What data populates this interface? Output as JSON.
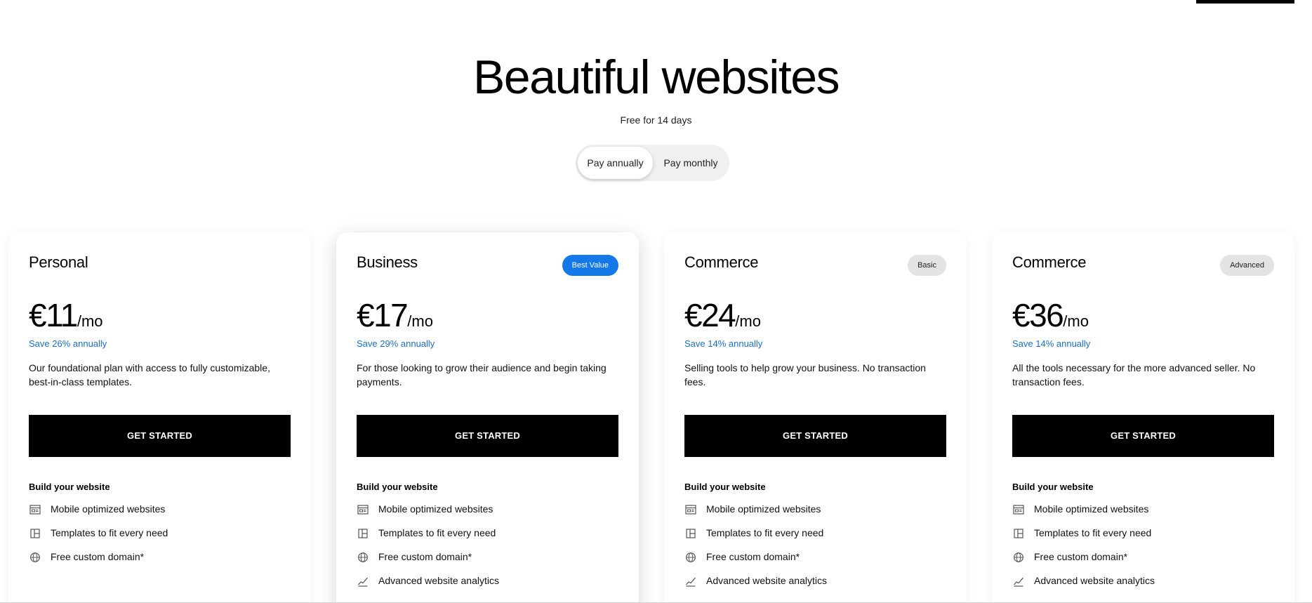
{
  "hero": {
    "title": "Beautiful websites",
    "subtitle": "Free for 14 days"
  },
  "billing_toggle": {
    "options": [
      "Pay annually",
      "Pay monthly"
    ],
    "selected": "Pay annually"
  },
  "plans": [
    {
      "name": "Personal",
      "badge": "",
      "price": "€11",
      "unit": "/mo",
      "savings": "Save 26% annually",
      "description": "Our foundational plan with access to fully customizable, best-in-class templates.",
      "cta": "GET STARTED",
      "feature_heading": "Build your website",
      "features": [
        {
          "icon": "browser-window-icon",
          "label": "Mobile optimized websites"
        },
        {
          "icon": "templates-layout-icon",
          "label": "Templates to fit every need"
        },
        {
          "icon": "globe-icon",
          "label": "Free custom domain*"
        }
      ]
    },
    {
      "name": "Business",
      "badge": "Best Value",
      "price": "€17",
      "unit": "/mo",
      "savings": "Save 29% annually",
      "description": "For those looking to grow their audience and begin taking payments.",
      "cta": "GET STARTED",
      "feature_heading": "Build your website",
      "features": [
        {
          "icon": "browser-window-icon",
          "label": "Mobile optimized websites"
        },
        {
          "icon": "templates-layout-icon",
          "label": "Templates to fit every need"
        },
        {
          "icon": "globe-icon",
          "label": "Free custom domain*"
        },
        {
          "icon": "analytics-trend-icon",
          "label": "Advanced website analytics"
        }
      ]
    },
    {
      "name": "Commerce",
      "badge": "Basic",
      "price": "€24",
      "unit": "/mo",
      "savings": "Save 14% annually",
      "description": "Selling tools to help grow your business. No transaction fees.",
      "cta": "GET STARTED",
      "feature_heading": "Build your website",
      "features": [
        {
          "icon": "browser-window-icon",
          "label": "Mobile optimized websites"
        },
        {
          "icon": "templates-layout-icon",
          "label": "Templates to fit every need"
        },
        {
          "icon": "globe-icon",
          "label": "Free custom domain*"
        },
        {
          "icon": "analytics-trend-icon",
          "label": "Advanced website analytics"
        }
      ]
    },
    {
      "name": "Commerce",
      "badge": "Advanced",
      "price": "€36",
      "unit": "/mo",
      "savings": "Save 14% annually",
      "description": "All the tools necessary for the more advanced seller. No transaction fees.",
      "cta": "GET STARTED",
      "feature_heading": "Build your website",
      "features": [
        {
          "icon": "browser-window-icon",
          "label": "Mobile optimized websites"
        },
        {
          "icon": "templates-layout-icon",
          "label": "Templates to fit every need"
        },
        {
          "icon": "globe-icon",
          "label": "Free custom domain*"
        },
        {
          "icon": "analytics-trend-icon",
          "label": "Advanced website analytics"
        }
      ]
    }
  ],
  "colors": {
    "accent_blue": "#1478e8",
    "savings_text": "#1a6fc4",
    "button_bg": "#000000",
    "toggle_bg": "#f0f0f0",
    "badge_gray": "#e3e3e3"
  }
}
